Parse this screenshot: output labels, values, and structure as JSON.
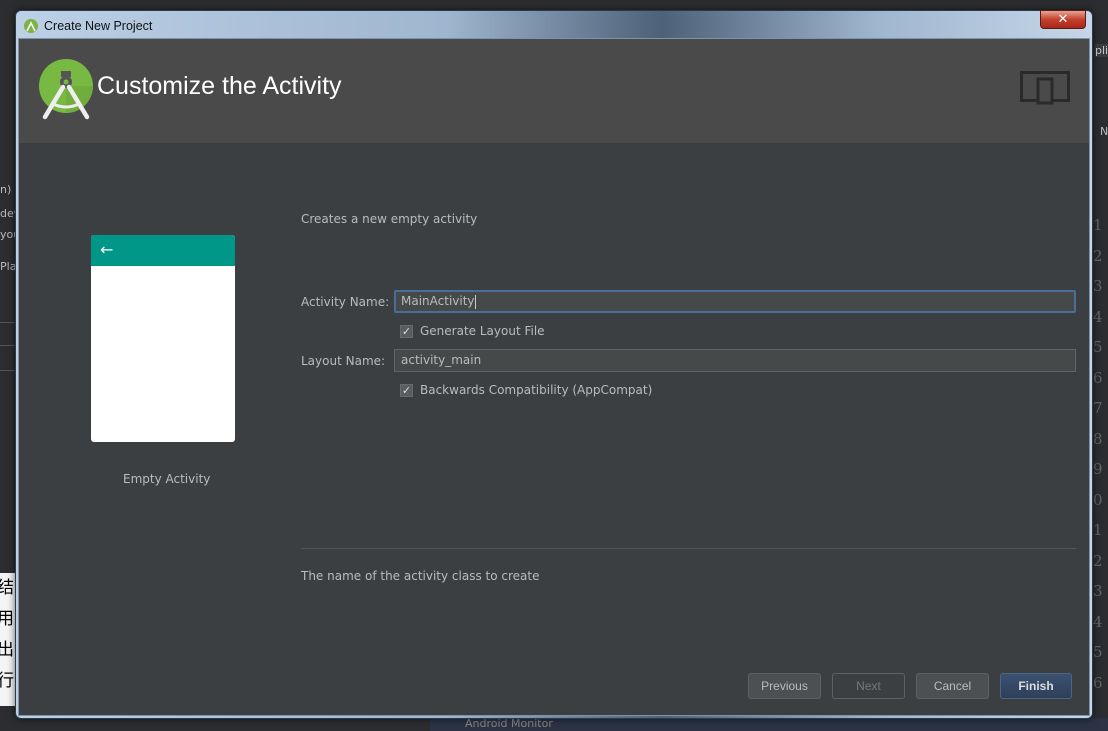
{
  "window": {
    "title": "Create New Project",
    "close_glyph": "✕"
  },
  "header": {
    "title": "Customize the Activity",
    "logo_icon": "android-studio-icon",
    "device_icon": "phone-tablet-icon"
  },
  "template": {
    "name": "Empty Activity",
    "back_glyph": "←",
    "toolbar_color": "#009688"
  },
  "description": "Creates a new empty activity",
  "form": {
    "activity_name_label": "Activity Name:",
    "activity_name_value": "MainActivity",
    "generate_layout_label": "Generate Layout File",
    "generate_layout_checked": true,
    "layout_name_label": "Layout Name:",
    "layout_name_value": "activity_main",
    "backwards_compat_label": "Backwards Compatibility (AppCompat)",
    "backwards_compat_checked": true
  },
  "hint": "The name of the activity class to create",
  "buttons": {
    "previous": "Previous",
    "next": "Next",
    "cancel": "Cancel",
    "finish": "Finish"
  },
  "background": {
    "left_fragments": [
      "n)",
      "dev",
      "you",
      "Pla"
    ],
    "cjk_fragments": [
      "结",
      "用",
      "出",
      "行"
    ],
    "right_fragments": [
      "pli",
      "N"
    ],
    "line_numbers": "1 2 3 4 5 6 7 8 9 0 1 2 3 4 5 6",
    "status_text": "Android Monitor"
  }
}
